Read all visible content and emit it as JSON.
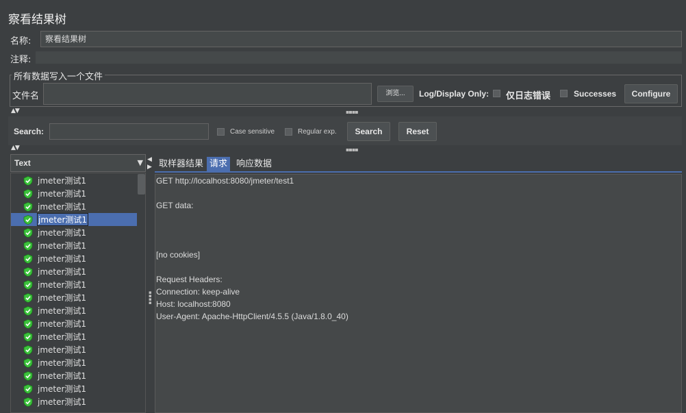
{
  "window": {
    "title": "察看结果树"
  },
  "form": {
    "name_label": "名称:",
    "name_value": "察看结果树",
    "comment_label": "注释:"
  },
  "file_section": {
    "legend": "所有数据写入一个文件",
    "filename_label": "文件名",
    "filename_value": "",
    "browse_label": "浏览...",
    "log_display_label": "Log/Display Only:",
    "errors_only_label": "仅日志错误",
    "successes_label": "Successes",
    "configure_label": "Configure"
  },
  "search": {
    "label": "Search:",
    "value": "",
    "case_sensitive_label": "Case sensitive",
    "regex_label": "Regular exp.",
    "search_button": "Search",
    "reset_button": "Reset"
  },
  "renderer": {
    "selected": "Text"
  },
  "tree": {
    "items": [
      "jmeter测试1",
      "jmeter测试1",
      "jmeter测试1",
      "jmeter测试1",
      "jmeter测试1",
      "jmeter测试1",
      "jmeter测试1",
      "jmeter测试1",
      "jmeter测试1",
      "jmeter测试1",
      "jmeter测试1",
      "jmeter测试1",
      "jmeter测试1",
      "jmeter测试1",
      "jmeter测试1",
      "jmeter测试1",
      "jmeter测试1",
      "jmeter测试1"
    ],
    "selected_index": 3,
    "status_icon": "green-shield-check-icon"
  },
  "tabs": [
    {
      "label": "取样器结果",
      "active": false
    },
    {
      "label": "请求",
      "active": true
    },
    {
      "label": "响应数据",
      "active": false
    }
  ],
  "request_lines": [
    "GET http://localhost:8080/jmeter/test1",
    "",
    "GET data:",
    "",
    "",
    "",
    "[no cookies]",
    "",
    "Request Headers:",
    "Connection: keep-alive",
    "Host: localhost:8080",
    "User-Agent: Apache-HttpClient/4.5.5 (Java/1.8.0_40)"
  ],
  "colors": {
    "background": "#3c3f41",
    "selection": "#4b6eaf",
    "success_icon": "#3cc23c"
  }
}
